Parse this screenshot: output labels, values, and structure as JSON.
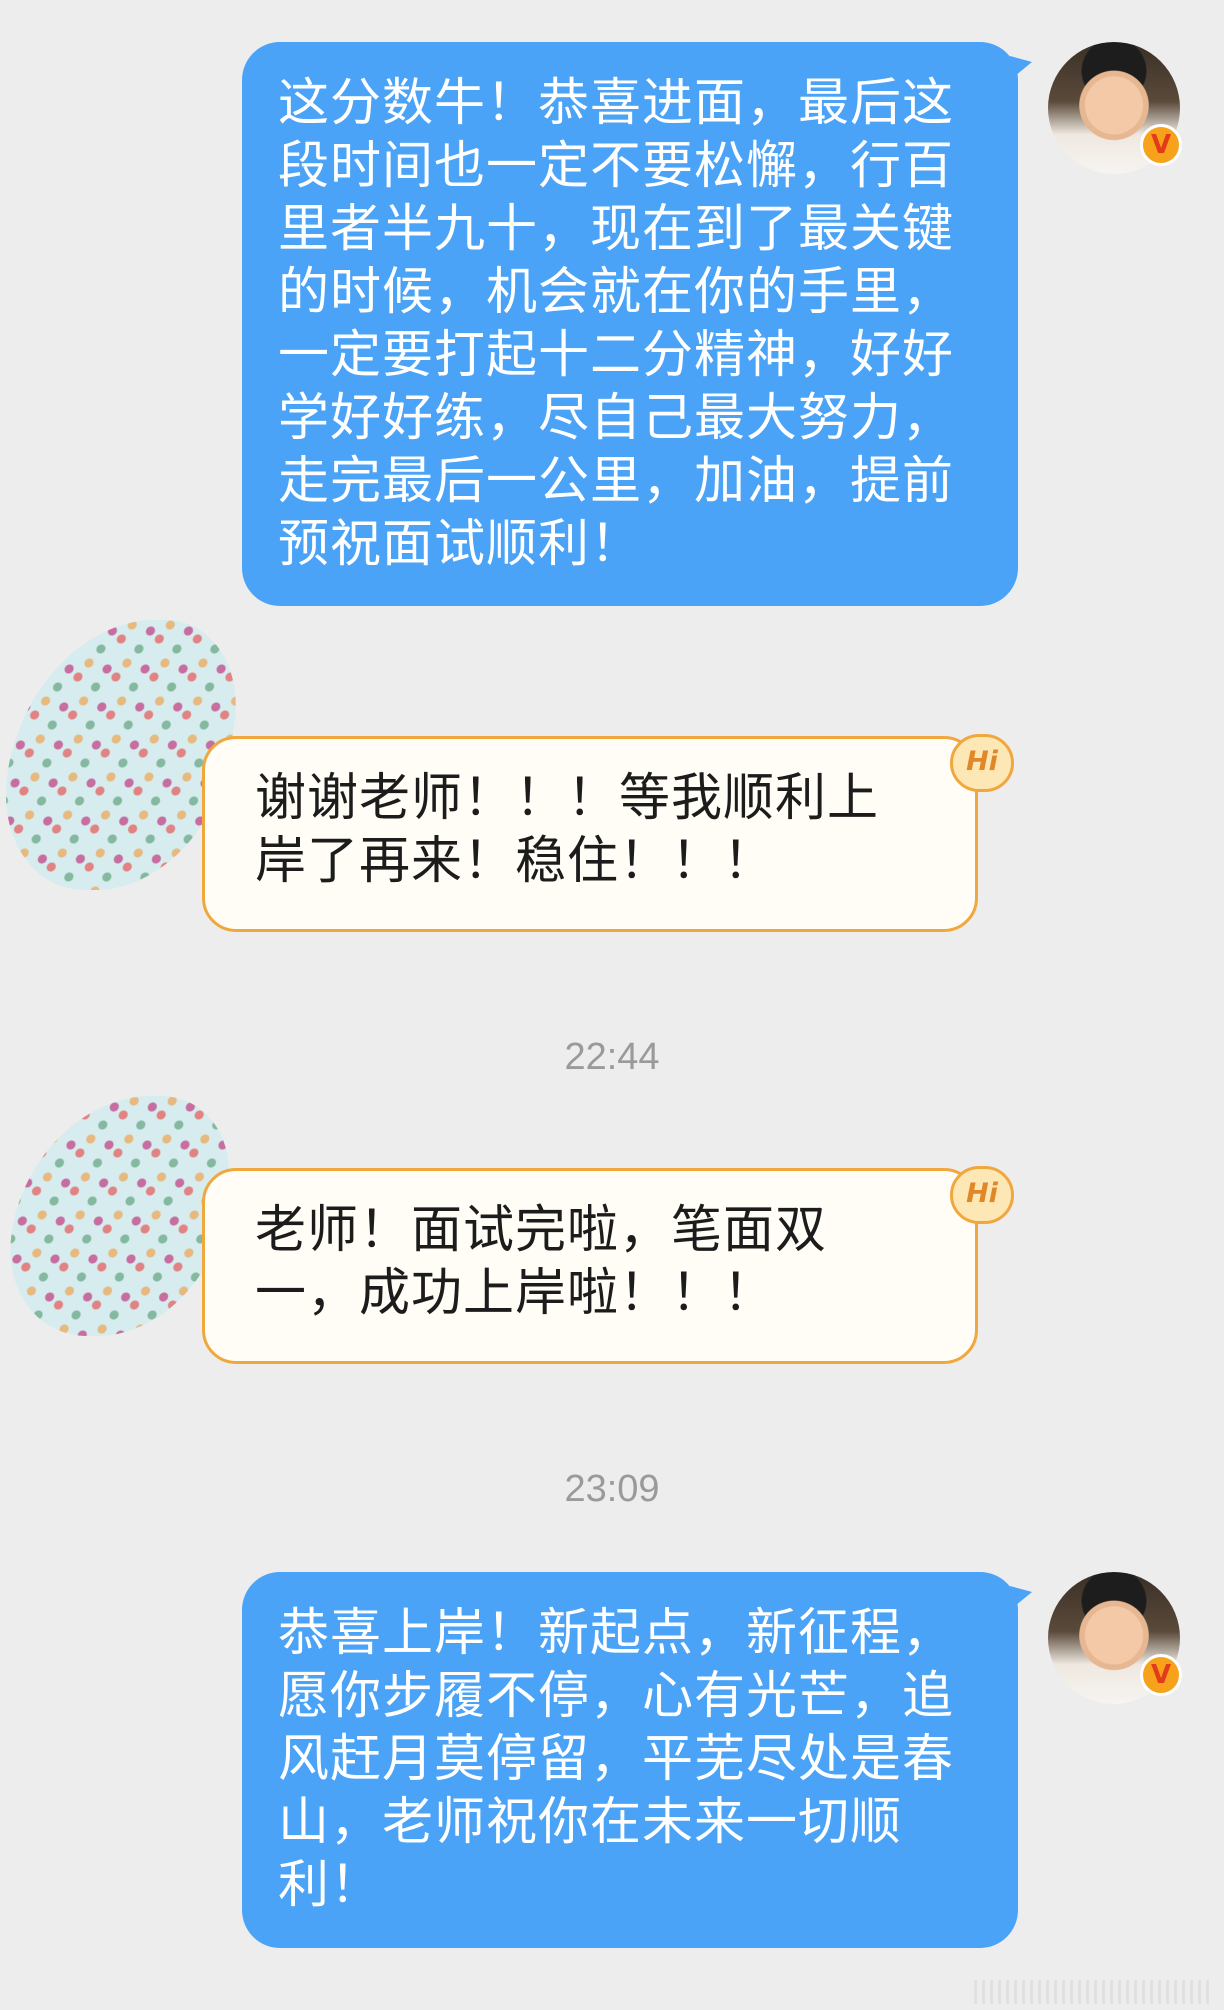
{
  "messages": [
    {
      "side": "out",
      "text": "这分数牛！恭喜进面，最后这段时间也一定不要松懈，行百里者半九十，现在到了最关键的时候，机会就在你的手里，一定要打起十二分精神，好好学好好练，尽自己最大努力，走完最后一公里，加油，提前预祝面试顺利！",
      "lines": [
        "这分数牛！恭喜进面，最后这",
        "段时间也一定不要松懈，行百",
        "里者半九十，现在到了最关键",
        "的时候，机会就在你的手里，",
        "一定要打起十二分精神，好好",
        "学好好练，尽自己最大努力，",
        "走完最后一公里，加油，提前",
        "预祝面试顺利！"
      ]
    },
    {
      "side": "in",
      "badge": "Hi",
      "lines": [
        "谢谢老师！！！等我顺利上",
        "岸了再来！稳住！！！"
      ]
    },
    {
      "side": "in",
      "badge": "Hi",
      "lines": [
        "老师！面试完啦，笔面双",
        "一，成功上岸啦！！！"
      ]
    },
    {
      "side": "out",
      "lines": [
        "恭喜上岸！新起点，新征程，",
        "愿你步履不停，心有光芒，追",
        "风赶月莫停留，平芜尽处是春",
        "山，老师祝你在未来一切顺",
        "利！"
      ]
    }
  ],
  "timestamps": [
    "22:44",
    "23:09"
  ],
  "avatar_badge": "V",
  "colors": {
    "background": "#ededed",
    "outgoing_bubble": "#4aa3f7",
    "incoming_bubble": "#fffdf6",
    "incoming_border": "#f0a83e",
    "timestamp_text": "#9a9a9a"
  }
}
